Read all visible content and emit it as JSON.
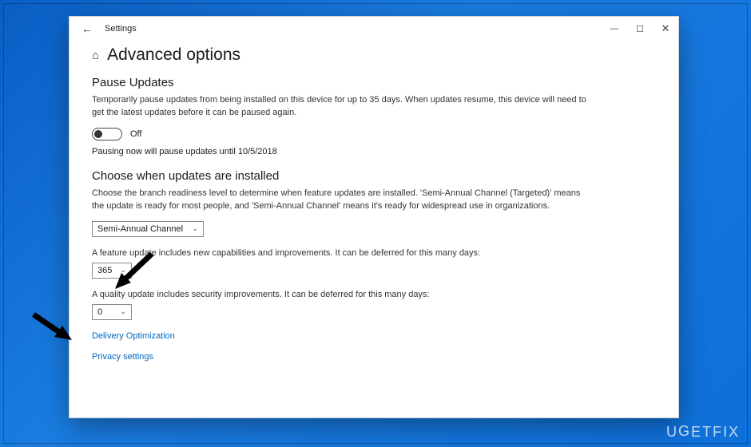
{
  "titlebar": {
    "app_name": "Settings"
  },
  "header": {
    "page_title": "Advanced options"
  },
  "pause_updates": {
    "heading": "Pause Updates",
    "description": "Temporarily pause updates from being installed on this device for up to 35 days. When updates resume, this device will need to get the latest updates before it can be paused again.",
    "toggle_state": "Off",
    "pause_note": "Pausing now will pause updates until 10/5/2018"
  },
  "choose_when": {
    "heading": "Choose when updates are installed",
    "description": "Choose the branch readiness level to determine when feature updates are installed. 'Semi-Annual Channel (Targeted)' means the update is ready for most people, and 'Semi-Annual Channel' means it's ready for widespread use in organizations.",
    "branch_value": "Semi-Annual Channel",
    "feature_label": "A feature update includes new capabilities and improvements. It can be deferred for this many days:",
    "feature_value": "365",
    "quality_label": "A quality update includes security improvements. It can be deferred for this many days:",
    "quality_value": "0"
  },
  "links": {
    "delivery": "Delivery Optimization",
    "privacy": "Privacy settings"
  },
  "watermark": "UGETFIX"
}
